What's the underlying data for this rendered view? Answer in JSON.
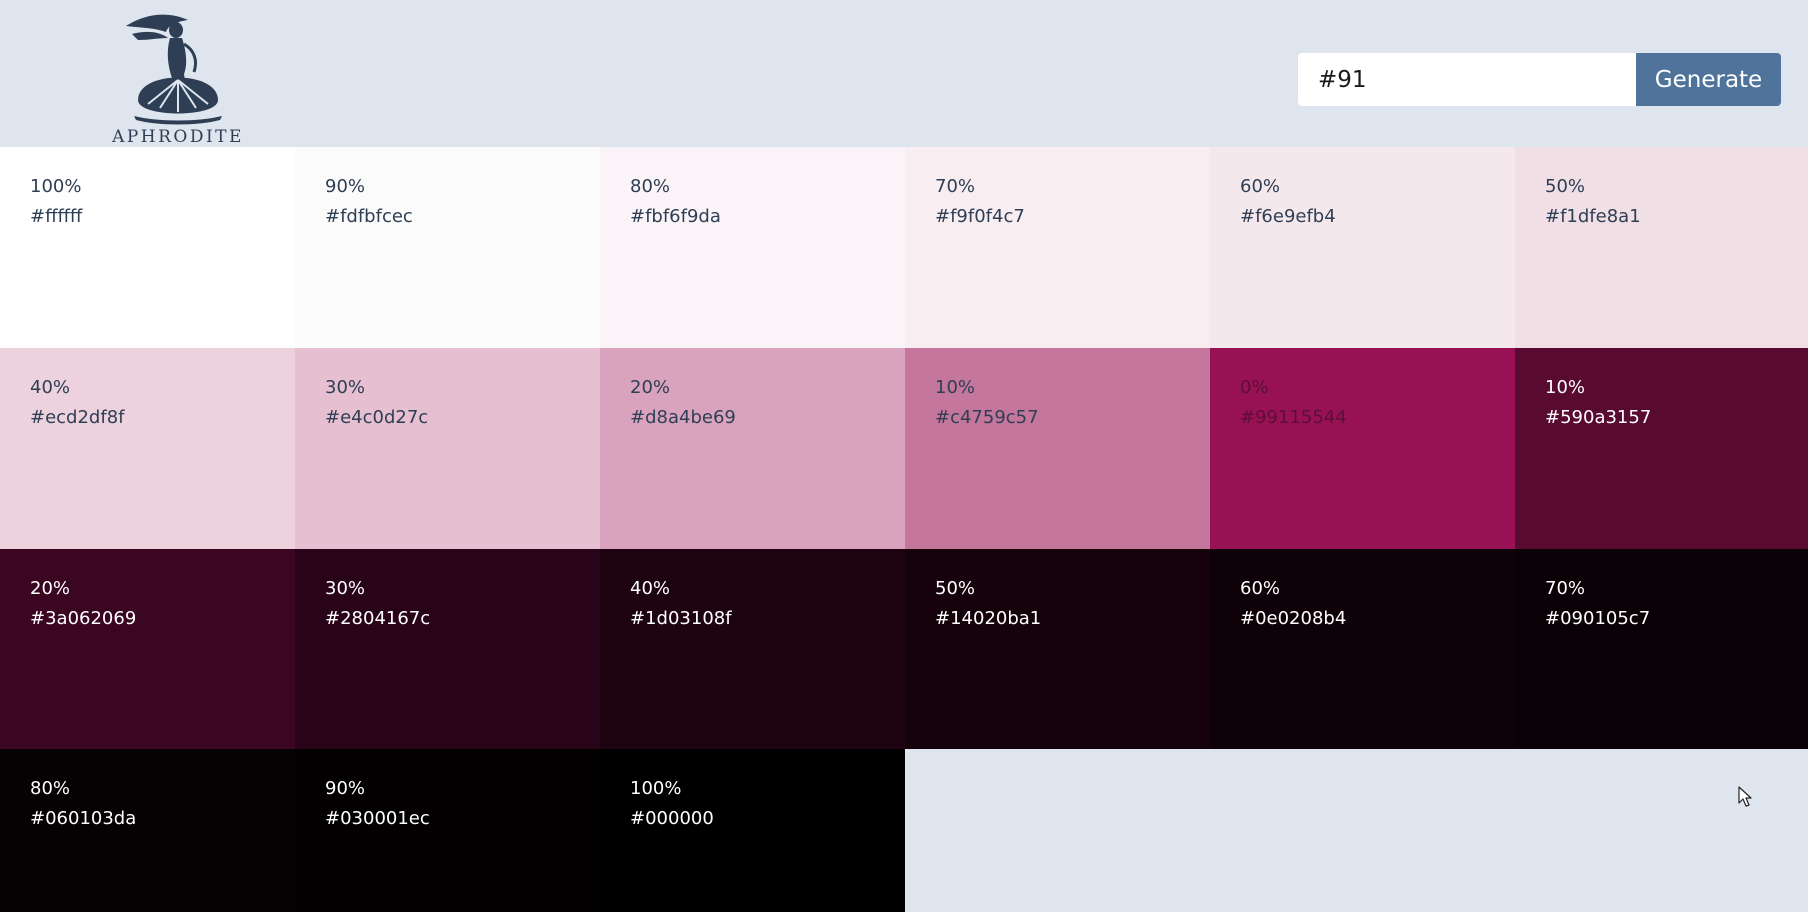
{
  "app": {
    "logo_text": "APHRODITE"
  },
  "search": {
    "value": "#91",
    "button_label": "Generate"
  },
  "icons": {
    "logo": "aphrodite-statue-on-shell-logo",
    "cursor": "mouse-pointer-icon"
  },
  "swatches": [
    {
      "label": "100%",
      "hex": "#ffffff",
      "color": "#ffffff",
      "text_color": "#2e3e54"
    },
    {
      "label": "90%",
      "hex": "#fdfbfcec",
      "color": "#fbfbfb",
      "text_color": "#2e3e54"
    },
    {
      "label": "80%",
      "hex": "#fbf6f9da",
      "color": "#faf4f8",
      "text_color": "#2e3e54"
    },
    {
      "label": "70%",
      "hex": "#f9f0f4c7",
      "color": "#f8eef2",
      "text_color": "#2e3e54"
    },
    {
      "label": "60%",
      "hex": "#f6e9efb4",
      "color": "#f4e8ec",
      "text_color": "#2e3e54"
    },
    {
      "label": "50%",
      "hex": "#f1dfe8a1",
      "color": "#f1dfe6",
      "text_color": "#2e3e54"
    },
    {
      "label": "40%",
      "hex": "#ecd2df8f",
      "color": "#edd1dd",
      "text_color": "#2e3e54"
    },
    {
      "label": "30%",
      "hex": "#e4c0d27c",
      "color": "#e6c0d1",
      "text_color": "#2e3e54"
    },
    {
      "label": "20%",
      "hex": "#d8a4be69",
      "color": "#d9a3be",
      "text_color": "#2e3e54"
    },
    {
      "label": "10%",
      "hex": "#c4759c57",
      "color": "#c4769c",
      "text_color": "#2e3e54"
    },
    {
      "label": "0%",
      "hex": "#99115544",
      "color": "#991155",
      "text_color": "#5a1035"
    },
    {
      "label": "10%",
      "hex": "#590a3157",
      "color": "#590a31",
      "text_color": "#ffffff"
    },
    {
      "label": "20%",
      "hex": "#3a062069",
      "color": "#3a0621",
      "text_color": "#ffffff"
    },
    {
      "label": "30%",
      "hex": "#2804167c",
      "color": "#290418",
      "text_color": "#ffffff"
    },
    {
      "label": "40%",
      "hex": "#1d03108f",
      "color": "#1e0311",
      "text_color": "#ffffff"
    },
    {
      "label": "50%",
      "hex": "#14020ba1",
      "color": "#15020b",
      "text_color": "#ffffff"
    },
    {
      "label": "60%",
      "hex": "#0e0208b4",
      "color": "#0e0208",
      "text_color": "#ffffff"
    },
    {
      "label": "70%",
      "hex": "#090105c7",
      "color": "#090105",
      "text_color": "#ffffff"
    },
    {
      "label": "80%",
      "hex": "#060103da",
      "color": "#060103",
      "text_color": "#ffffff"
    },
    {
      "label": "90%",
      "hex": "#030001ec",
      "color": "#030001",
      "text_color": "#ffffff"
    },
    {
      "label": "100%",
      "hex": "#000000",
      "color": "#000000",
      "text_color": "#ffffff"
    }
  ]
}
